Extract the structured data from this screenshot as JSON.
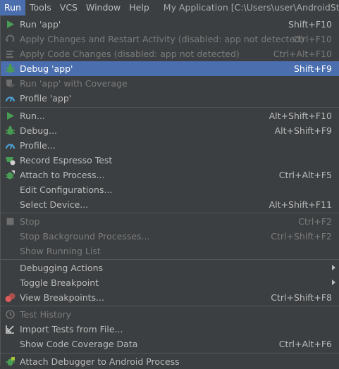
{
  "menubar": {
    "items": [
      "Run",
      "Tools",
      "VCS",
      "Window",
      "Help"
    ],
    "title": "My Application [C:\\Users\\user\\AndroidStudi"
  },
  "menu": {
    "items": [
      {
        "label": "Run 'app'",
        "shortcut": "Shift+F10",
        "icon": "run-icon"
      },
      {
        "label": "Apply Changes and Restart Activity (disabled: app not detected)",
        "shortcut": "Ctrl+F10",
        "icon": "apply-changes-icon"
      },
      {
        "label": "Apply Code Changes (disabled: app not detected)",
        "shortcut": "Ctrl+Alt+F10",
        "icon": "apply-code-icon"
      },
      {
        "label": "Debug 'app'",
        "shortcut": "Shift+F9",
        "icon": "debug-icon"
      },
      {
        "label": "Run 'app' with Coverage",
        "shortcut": "",
        "icon": "coverage-icon"
      },
      {
        "label": "Profile 'app'",
        "shortcut": "",
        "icon": "profile-icon"
      },
      {
        "label": "Run...",
        "shortcut": "Alt+Shift+F10",
        "icon": "run-icon"
      },
      {
        "label": "Debug...",
        "shortcut": "Alt+Shift+F9",
        "icon": "debug-icon"
      },
      {
        "label": "Profile...",
        "shortcut": "",
        "icon": "profile-icon"
      },
      {
        "label": "Record Espresso Test",
        "shortcut": "",
        "icon": "espresso-icon"
      },
      {
        "label": "Attach to Process...",
        "shortcut": "Ctrl+Alt+F5",
        "icon": "attach-icon"
      },
      {
        "label": "Edit Configurations...",
        "shortcut": "",
        "icon": ""
      },
      {
        "label": "Select Device...",
        "shortcut": "Alt+Shift+F11",
        "icon": ""
      },
      {
        "label": "Stop",
        "shortcut": "Ctrl+F2",
        "icon": "stop-icon"
      },
      {
        "label": "Stop Background Processes...",
        "shortcut": "Ctrl+Shift+F2",
        "icon": ""
      },
      {
        "label": "Show Running List",
        "shortcut": "",
        "icon": ""
      },
      {
        "label": "Debugging Actions",
        "shortcut": "",
        "icon": ""
      },
      {
        "label": "Toggle Breakpoint",
        "shortcut": "",
        "icon": ""
      },
      {
        "label": "View Breakpoints...",
        "shortcut": "Ctrl+Shift+F8",
        "icon": "breakpoints-icon"
      },
      {
        "label": "Test History",
        "shortcut": "",
        "icon": "history-icon"
      },
      {
        "label": "Import Tests from File...",
        "shortcut": "",
        "icon": "import-icon"
      },
      {
        "label": "Show Code Coverage Data",
        "shortcut": "Ctrl+Alt+F6",
        "icon": ""
      },
      {
        "label": "Attach Debugger to Android Process",
        "shortcut": "",
        "icon": "android-debug-icon"
      }
    ]
  },
  "colors": {
    "selection": "#4b6eaf",
    "background": "#3c3f41",
    "green": "#499c54",
    "disabled": "#7b7b7b"
  }
}
